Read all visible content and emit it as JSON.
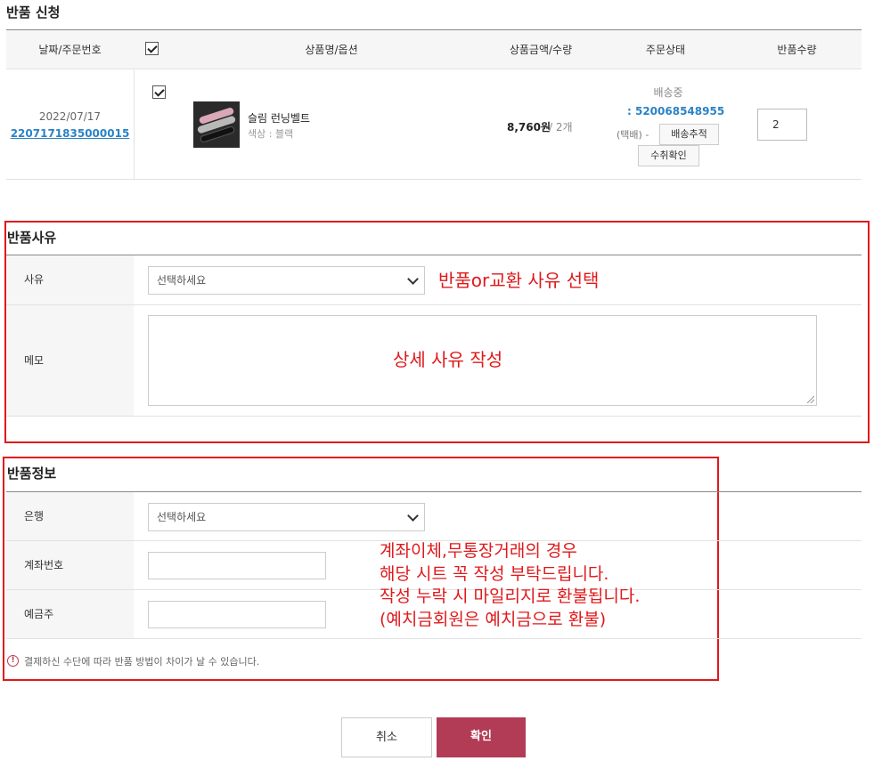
{
  "order": {
    "title": "반품 신청",
    "headers": {
      "date_order": "날짜/주문번호",
      "product": "상품명/옵션",
      "price_qty": "상품금액/수량",
      "status": "주문상태",
      "return_qty": "반품수량"
    },
    "row": {
      "date": "2022/07/17",
      "order_no": "2207171835000015",
      "product_name": "슬림 런닝벨트",
      "option": "색상 : 블랙",
      "price": "8,760원",
      "qty": "/ 2개",
      "status": "배송중",
      "tracking_no": ": 520068548955",
      "carrier": "(택배) -",
      "track_btn": "배송추적",
      "confirm_btn": "수취확인",
      "return_qty_value": "2"
    }
  },
  "reason": {
    "title": "반품사유",
    "reason_label": "사유",
    "reason_select": "선택하세요",
    "memo_label": "메모",
    "annotation_select": "반품or교환 사유 선택",
    "annotation_memo": "상세 사유 작성"
  },
  "refund": {
    "title": "반품정보",
    "bank_label": "은행",
    "bank_select": "선택하세요",
    "account_label": "계좌번호",
    "holder_label": "예금주",
    "notice": "결제하신 수단에 따라 반품 방법이 차이가 날 수 있습니다.",
    "annotation_lines": [
      "계좌이체,무통장거래의 경우",
      "해당 시트 꼭 작성 부탁드립니다.",
      "작성 누락 시 마일리지로 환불됩니다.",
      "(예치금회원은 예치금으로 환불)"
    ]
  },
  "actions": {
    "cancel": "취소",
    "confirm": "확인"
  },
  "colors": {
    "accent": "#b23b55",
    "link": "#2b83c5",
    "annotation": "#e0191b"
  }
}
